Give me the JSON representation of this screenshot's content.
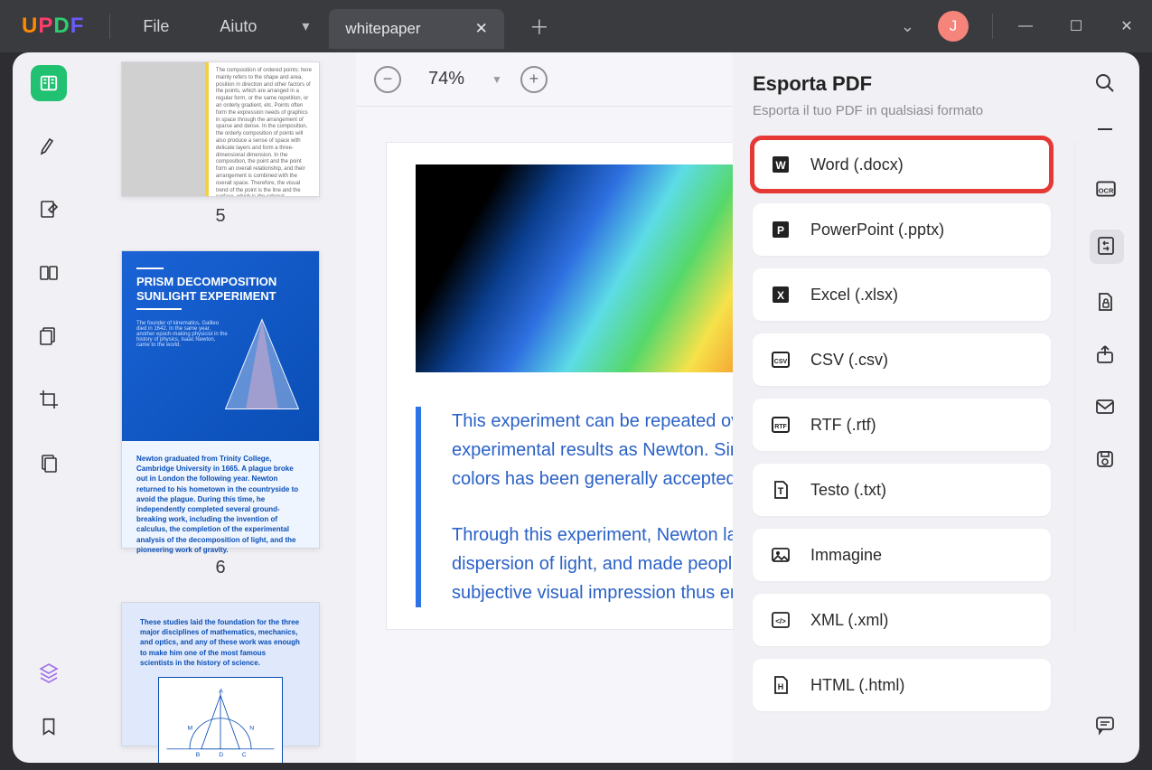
{
  "app": {
    "logo_letters": [
      "U",
      "P",
      "D",
      "F"
    ]
  },
  "menu": {
    "file": "File",
    "help": "Aiuto"
  },
  "tab": {
    "title": "whitepaper"
  },
  "avatar": {
    "initial": "J"
  },
  "zoom": {
    "value": "74%"
  },
  "thumbs": {
    "p5": {
      "num": "5",
      "text": "The composition of ordered points: here mainly refers to the shape and area, position in direction and other factors of the points, which are arranged in a regular form, or the same repetition, or an orderly gradient, etc. Points often form the expression needs of graphics in space through the arrangement of sparse and dense. In the composition, the orderly composition of points will also produce a sense of space with delicate layers and form a three-dimensional dimension. In the composition, the point and the point form an overall relationship, and their arrangement is combined with the overall space. Therefore, the visual trend of the point is the line and the surface, which is the rational composition method of the point."
    },
    "p6": {
      "num": "6",
      "title": "PRISM DECOMPOSITION SUNLIGHT EXPERIMENT",
      "hero_text": "The founder of kinematics, Galileo died in 1642. In the same year, another epoch-making physicist in the history of physics, Isaac Newton, came to the world.",
      "foot_text": "Newton graduated from Trinity College, Cambridge University in 1665. A plague broke out in London the following year. Newton returned to his hometown in the countryside to avoid the plague. During this time, he independently completed several ground-breaking work, including the invention of calculus, the completion of the experimental analysis of the decomposition of light, and the pioneering work of gravity."
    },
    "p7": {
      "text": "These studies laid the foundation for the three major disciplines of mathematics, mechanics, and optics, and any of these work was enough to make him one of the most famous scientists in the history of science."
    }
  },
  "document": {
    "para1": "This experiment can be repeated over and over again and get the same experimental results as Newton. Since then, the theory of the seven colors has been generally accepted.",
    "para2": "Through this experiment, Newton laid the foundation for the theory of dispersion of light, and made people's interpretation of color from subjective visual impression thus embarking on a scientific"
  },
  "export": {
    "title": "Esporta PDF",
    "subtitle": "Esporta il tuo PDF in qualsiasi formato",
    "options": [
      {
        "id": "word",
        "label": "Word (.docx)"
      },
      {
        "id": "powerpoint",
        "label": "PowerPoint (.pptx)"
      },
      {
        "id": "excel",
        "label": "Excel (.xlsx)"
      },
      {
        "id": "csv",
        "label": "CSV (.csv)"
      },
      {
        "id": "rtf",
        "label": "RTF (.rtf)"
      },
      {
        "id": "txt",
        "label": "Testo (.txt)"
      },
      {
        "id": "image",
        "label": "Immagine"
      },
      {
        "id": "xml",
        "label": "XML (.xml)"
      },
      {
        "id": "html",
        "label": "HTML (.html)"
      }
    ]
  }
}
